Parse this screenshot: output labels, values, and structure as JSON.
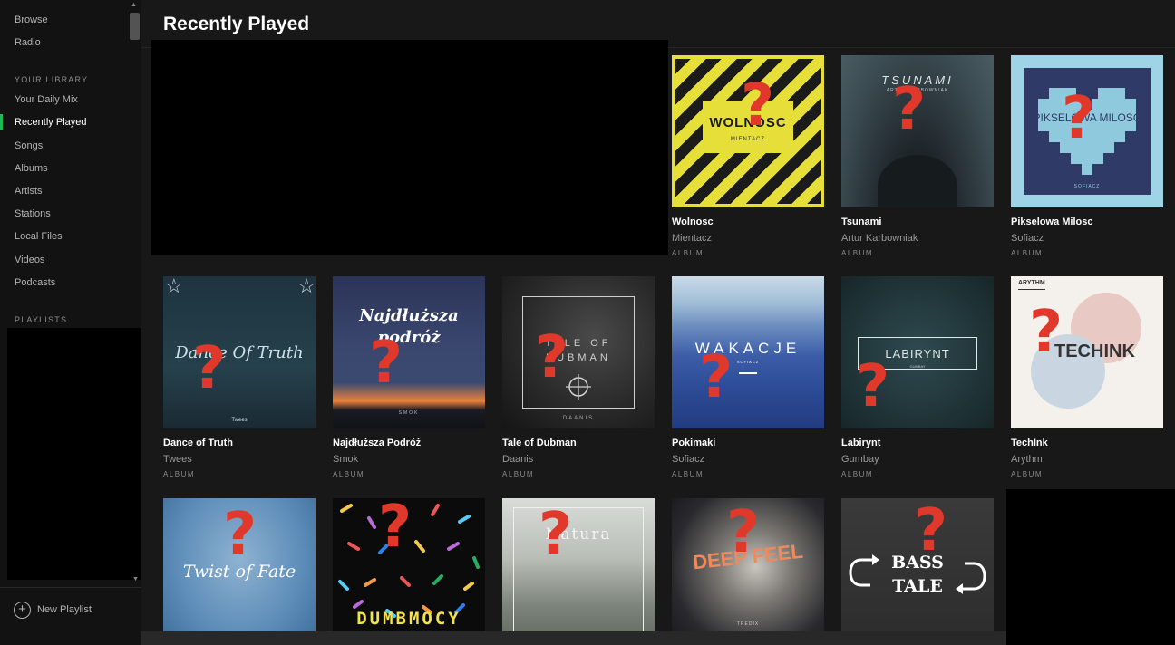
{
  "sidebar": {
    "nav_top": [
      "Browse",
      "Radio"
    ],
    "library_label": "YOUR LIBRARY",
    "library_items": [
      "Your Daily Mix",
      "Recently Played",
      "Songs",
      "Albums",
      "Artists",
      "Stations",
      "Local Files",
      "Videos",
      "Podcasts"
    ],
    "active_item": "Recently Played",
    "playlists_label": "PLAYLISTS",
    "new_playlist": "New Playlist"
  },
  "main": {
    "title": "Recently Played",
    "type_label": "ALBUM",
    "albums": [
      {
        "title": "Wolnosc",
        "artist": "Mientacz",
        "cover_text": "WOLNOSC",
        "cover_sub": "MIENTACZ"
      },
      {
        "title": "Tsunami",
        "artist": "Artur Karbowniak",
        "cover_text": "TSUNAMI",
        "cover_sub": "ARTUR KARBOWNIAK"
      },
      {
        "title": "Pikselowa Milosc",
        "artist": "Sofiacz",
        "cover_text": "PIKSELOWA MILOSC",
        "cover_sub": "SOFIACZ"
      },
      {
        "title": "Dance of Truth",
        "artist": "Twees",
        "cover_text": "Dance Of Truth",
        "cover_sub": "Twees"
      },
      {
        "title": "Najdłuższa Podróż",
        "artist": "Smok",
        "cover_text": "Najdłuższa podróż",
        "cover_sub": "SMOK"
      },
      {
        "title": "Tale of Dubman",
        "artist": "Daanis",
        "cover_text": "TALE OF DUBMAN",
        "cover_sub": "DAANIS"
      },
      {
        "title": "Pokimaki",
        "artist": "Sofiacz",
        "cover_text": "WAKACJE",
        "cover_sub": "SOFIACZ"
      },
      {
        "title": "Labirynt",
        "artist": "Gumbay",
        "cover_text": "LABIRYNT",
        "cover_sub": "GUMBAY"
      },
      {
        "title": "TechInk",
        "artist": "Arythm",
        "cover_text": "TECHINK",
        "cover_sub": "ARYTHM"
      },
      {
        "title": "",
        "artist": "",
        "cover_text": "Twist of Fate",
        "cover_sub": ""
      },
      {
        "title": "",
        "artist": "",
        "cover_text": "DUMBMOCY",
        "cover_sub": ""
      },
      {
        "title": "",
        "artist": "",
        "cover_text": "Natura",
        "cover_sub": ""
      },
      {
        "title": "",
        "artist": "",
        "cover_text": "DEEP FEEL",
        "cover_sub": "TREDIX"
      },
      {
        "title": "",
        "artist": "",
        "cover_text": "BASS TALE",
        "cover_sub": ""
      }
    ],
    "question_mark": "?"
  },
  "colors": {
    "accent_green": "#1db954",
    "question_red": "#e0392b"
  }
}
